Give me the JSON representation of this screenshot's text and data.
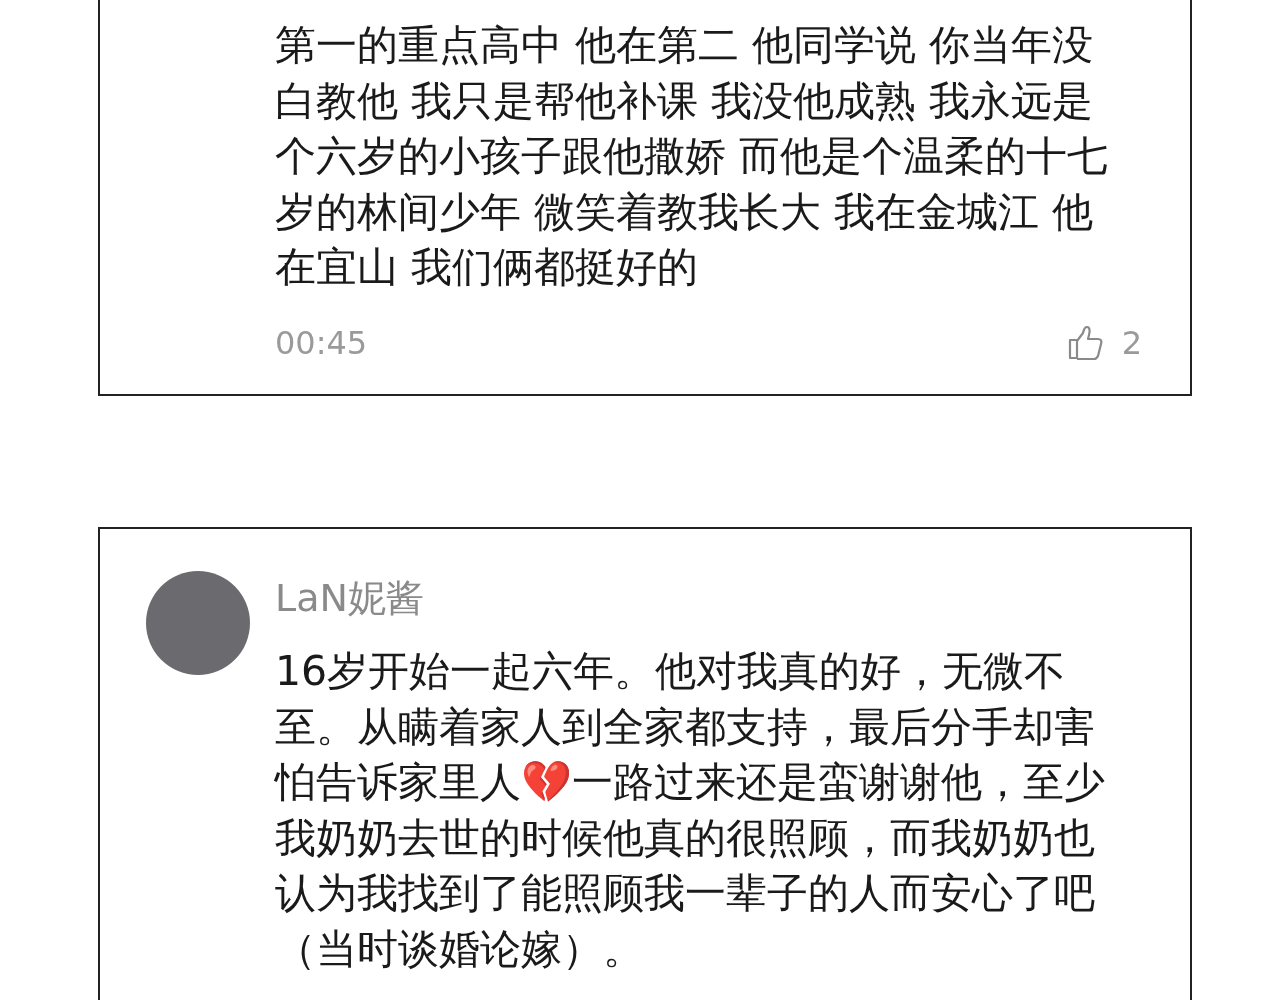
{
  "comments": [
    {
      "kind": "continued",
      "text": "第一的重点高中 他在第二 他同学说 你当年没白教他 我只是帮他补课 我没他成熟 我永远是个六岁的小孩子跟他撒娇 而他是个温柔的十七岁的林间少年 微笑着教我长大 我在金城江 他在宜山 我们俩都挺好的",
      "time": "00:45",
      "likes": "2"
    },
    {
      "kind": "full",
      "author": "LaN妮酱",
      "text": "16岁开始一起六年。他对我真的好，无微不至。从瞒着家人到全家都支持，最后分手却害怕告诉家里人💔一路过来还是蛮谢谢他，至少我奶奶去世的时候他真的很照顾，而我奶奶也认为我找到了能照顾我一辈子的人而安心了吧（当时谈婚论嫁）。"
    }
  ]
}
